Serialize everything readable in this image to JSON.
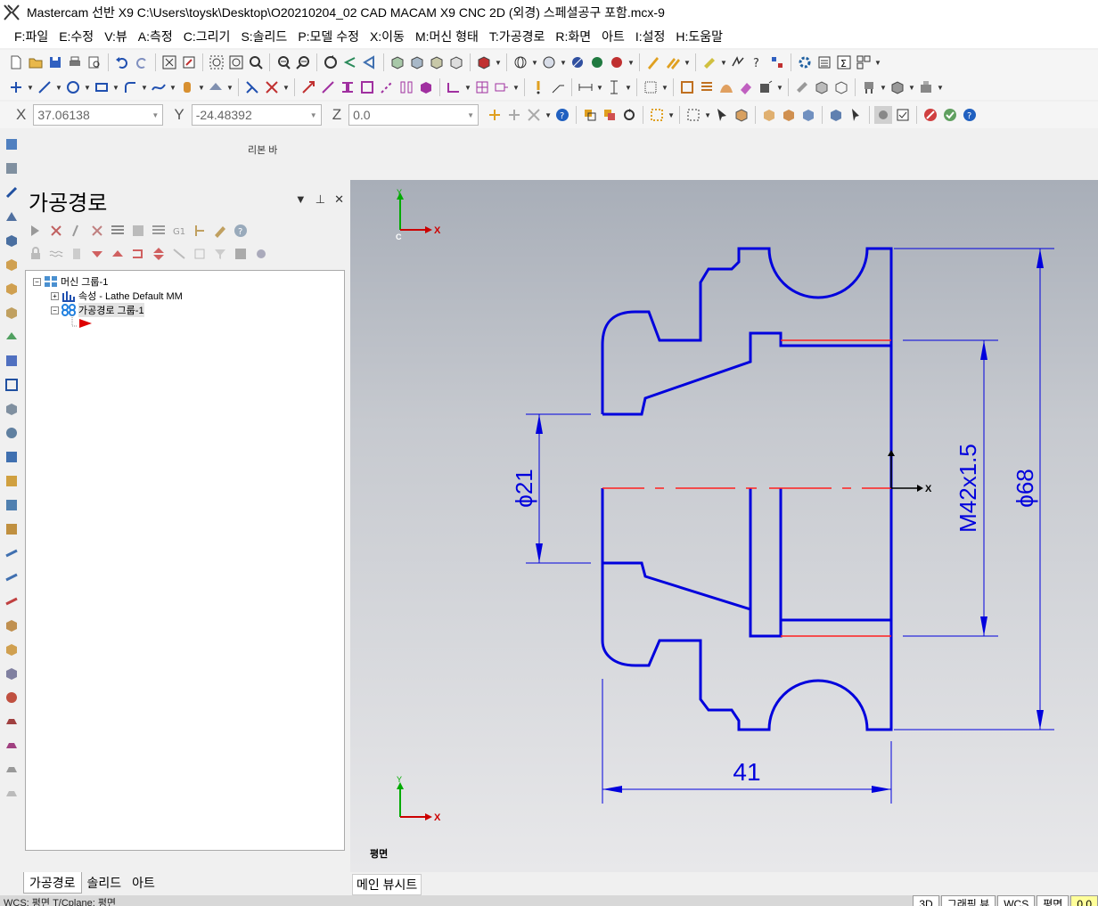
{
  "window": {
    "title": "Mastercam 선반 X9  C:\\Users\\toysk\\Desktop\\O20210204_02 CAD MACAM X9 CNC 2D (외경) 스페셜공구 포함.mcx-9"
  },
  "menu": [
    "F:파일",
    "E:수정",
    "V:뷰",
    "A:측정",
    "C:그리기",
    "S:솔리드",
    "P:모델 수정",
    "X:이동",
    "M:머신 형태",
    "T:가공경로",
    "R:화면",
    "아트",
    "I:설정",
    "H:도움말"
  ],
  "coords": {
    "x_label": "X",
    "x_value": "37.06138",
    "y_label": "Y",
    "y_value": "-24.48392",
    "z_label": "Z",
    "z_value": "0.0"
  },
  "ribbon_label": "리본 바",
  "panel": {
    "title": "가공경로",
    "tree": {
      "root": "머신 그룹-1",
      "properties": "속성 - Lathe Default MM",
      "toolpath_group": "가공경로 그룹-1"
    },
    "tabs": [
      "가공경로",
      "솔리드",
      "아트"
    ]
  },
  "viewport": {
    "view_name": "평면",
    "tab": "메인 뷰시트",
    "dimensions": {
      "d21": "ϕ21",
      "m42": "M42x1.5",
      "d68": "ϕ68",
      "len": "41"
    },
    "axis": {
      "x": "X",
      "y": "Y",
      "c": "C"
    },
    "colors": {
      "geometry": "#0000dd",
      "centerline": "#ff2020",
      "axis_x": "#cc0000",
      "axis_y": "#00aa00"
    }
  },
  "status": {
    "left": "WCS: 평면  T/Cplane: 평면",
    "right": [
      "3D",
      "그래픽 뷰",
      "WCS",
      "평면",
      "0.0"
    ]
  }
}
